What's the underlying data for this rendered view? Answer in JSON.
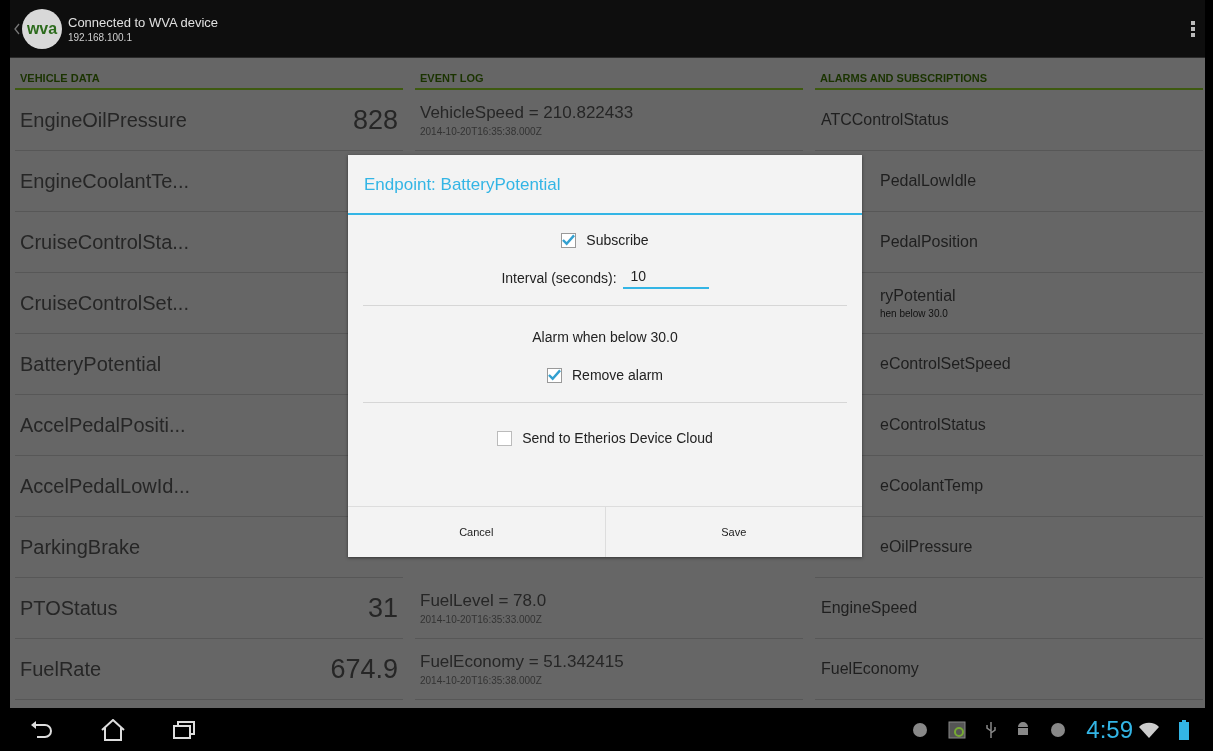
{
  "action_bar": {
    "logo_text": "wva",
    "title": "Connected to WVA device",
    "subtitle": "192.168.100.1"
  },
  "columns": {
    "vehicle_data": {
      "heading": "VEHICLE DATA",
      "items": [
        {
          "name": "EngineOilPressure",
          "value": "828"
        },
        {
          "name": "EngineCoolantTe..."
        },
        {
          "name": "CruiseControlSta..."
        },
        {
          "name": "CruiseControlSet..."
        },
        {
          "name": "BatteryPotential"
        },
        {
          "name": "AccelPedalPositi..."
        },
        {
          "name": "AccelPedalLowId..."
        },
        {
          "name": "ParkingBrake"
        },
        {
          "name": "PTOStatus",
          "value": "31"
        },
        {
          "name": "FuelRate",
          "value": "674.9"
        }
      ]
    },
    "event_log": {
      "heading": "EVENT LOG",
      "entries": [
        {
          "text": "VehicleSpeed = 210.822433",
          "time": "2014-10-20T16:35:38.000Z"
        },
        {
          "text": "FuelLevel = 78.0",
          "time": "2014-10-20T16:35:33.000Z"
        },
        {
          "text": "FuelEconomy = 51.342415",
          "time": "2014-10-20T16:35:38.000Z"
        }
      ]
    },
    "alarms_and_subscriptions": {
      "heading": "ALARMS AND SUBSCRIPTIONS",
      "items": [
        {
          "name": "ATCControlStatus",
          "clipped_by_dialog": false
        },
        {
          "name": "PedalLowIdle",
          "clipped_by_dialog": true
        },
        {
          "name": "PedalPosition",
          "clipped_by_dialog": true
        },
        {
          "name": "ryPotential",
          "detail": "hen below 30.0",
          "clipped_by_dialog": true
        },
        {
          "name": "eControlSetSpeed",
          "clipped_by_dialog": true
        },
        {
          "name": "eControlStatus",
          "clipped_by_dialog": true
        },
        {
          "name": "eCoolantTemp",
          "clipped_by_dialog": true
        },
        {
          "name": "eOilPressure",
          "clipped_by_dialog": true
        },
        {
          "name": "EngineSpeed",
          "clipped_by_dialog": false
        },
        {
          "name": "FuelEconomy",
          "clipped_by_dialog": false
        }
      ]
    }
  },
  "dialog": {
    "title": "Endpoint: BatteryPotential",
    "subscribe": {
      "label": "Subscribe",
      "checked": true
    },
    "interval": {
      "label": "Interval (seconds):",
      "value": "10"
    },
    "alarm_text": "Alarm when below 30.0",
    "remove_alarm": {
      "label": "Remove alarm",
      "checked": true
    },
    "send_to_cloud": {
      "label": "Send to Etherios Device Cloud",
      "checked": false
    },
    "buttons": [
      {
        "label": "Cancel"
      },
      {
        "label": "Save"
      }
    ]
  },
  "system_bar": {
    "time": "4:59"
  }
}
